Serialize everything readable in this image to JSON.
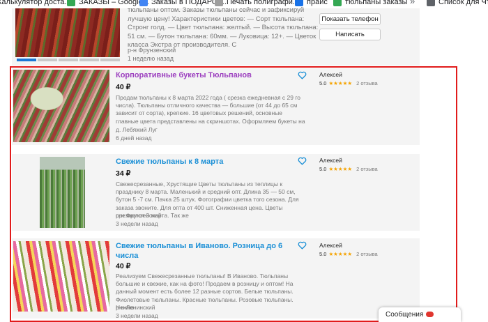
{
  "bookmarks": [
    {
      "label": "Калькулятор доста...",
      "color": "#e53935"
    },
    {
      "label": "ЗАКАЗЫ – Google...",
      "color": "#34a853"
    },
    {
      "label": "Заказы в ПОДАРОК...",
      "color": "#4285f4"
    },
    {
      "label": "Печать полиграфи...",
      "color": "#9e9e9e"
    },
    {
      "label": "прайс",
      "color": "#1a73e8"
    },
    {
      "label": "тюльпаны заказы",
      "color": "#34a853"
    },
    {
      "label": "Список для Чтени",
      "color": "#5f6368"
    }
  ],
  "bookmarks_more": "»",
  "previous_listing": {
    "description": "тюльпаны оптом. Заказы тюльпаны сейчас и зафиксируй лучшую цену! Характеристики цветов: — Сорт тюльпана: Стронг голд. — Цвет тюльпана: желтый. — Высота тюльпана: 51 см. — Бутон тюльпана: 60мм. — Луковица: 12+. — Цветок класса Экстра от производителя. С",
    "location": "р-н Фрунзенский",
    "time": "1 неделю назад",
    "show_phone": "Показать телефон",
    "write": "Написать"
  },
  "listings": [
    {
      "title": "Корпоративные букеты Тюльпанов",
      "price": "40 ₽",
      "description": "Продам тюльпаны к 8 марта 2022 года ( срезка ежедневная с 29 го числа). Тюльпаны отличного качества — большие (от 44 до 65 см зависит от сорта), крепкие. 16 цветовых решений, основные главные цвета представлены на скриншотах. Оформляем букеты на",
      "location": "д. Лебяжий Луг",
      "time": "6 дней назад",
      "seller": "Алексей",
      "rating": "5.0",
      "stars": "★★★★★",
      "reviews": "2 отзыва"
    },
    {
      "title": "Свежие тюльпаны к 8 марта",
      "price": "34 ₽",
      "description": "Свежесрезанные, Хрустящие Цветы тюльпаны из теплицы к празднику 8 марта. Маленький и средний опт. Длина 35 — 50 см, бутон 5 -7 см. Пачка 25 штук. Фотографии цветка того сезона. Для заказа звоните. Для опта от 400 шт. Сниженная цена. Цветы срезаются 3 марта. Так же",
      "location": "р-н Фрунзенский",
      "time": "3 недели назад",
      "seller": "Алексей",
      "rating": "5.0",
      "stars": "★★★★★",
      "reviews": "2 отзыва"
    },
    {
      "title": "Свежие тюльпаны в Иваново. Розница до 6 числа",
      "price": "40 ₽",
      "description": "Реализуем Свежесрезанные тюльпаны! В Иваново. Тюльпаны большие и свежие, как на фото! Продаем в розницу и оптом! На данный момент есть более 12 разные сортов. Белые тюльпаны. Фиолетовые тюльпаны. Красные тюльпаны. Розовые тюльпаны. Нежно",
      "location": "р-н Ленинский",
      "time": "3 недели назад",
      "seller": "Алексей",
      "rating": "5.0",
      "stars": "★★★★★",
      "reviews": "2 отзыва"
    }
  ],
  "messages": {
    "label": "Сообщения"
  },
  "colors": {
    "link": "#1a8fd6",
    "visited": "#9c3fbf",
    "star": "#f5a300",
    "highlight": "#e11b1b"
  }
}
